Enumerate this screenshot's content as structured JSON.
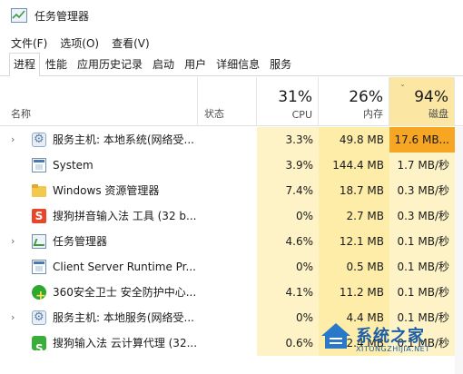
{
  "window": {
    "title": "任务管理器"
  },
  "menu": [
    "文件(F)",
    "选项(O)",
    "查看(V)"
  ],
  "tabs": [
    "进程",
    "性能",
    "应用历史记录",
    "启动",
    "用户",
    "详细信息",
    "服务"
  ],
  "active_tab": 0,
  "columns": {
    "name": "名称",
    "status": "状态",
    "cpu": {
      "pct": "31%",
      "label": "CPU"
    },
    "memory": {
      "pct": "26%",
      "label": "内存"
    },
    "disk": {
      "pct": "94%",
      "label": "磁盘",
      "sort": "ˇ"
    }
  },
  "processes": [
    {
      "expand": "›",
      "icon": "gear-icon",
      "name": "服务主机: 本地系统(网络受...",
      "cpu": "3.3%",
      "memory": "49.8 MB",
      "disk": "17.6 MB...",
      "disk_level": "high"
    },
    {
      "expand": "",
      "icon": "window-icon",
      "name": "System",
      "cpu": "3.9%",
      "memory": "144.4 MB",
      "disk": "1.7 MB/秒",
      "disk_level": "low"
    },
    {
      "expand": "",
      "icon": "folder-icon",
      "name": "Windows 资源管理器",
      "cpu": "7.4%",
      "memory": "18.7 MB",
      "disk": "0.3 MB/秒",
      "disk_level": "low"
    },
    {
      "expand": "",
      "icon": "sogou-icon",
      "icon_text": "S",
      "name": "搜狗拼音输入法 工具 (32 b...",
      "cpu": "0%",
      "memory": "2.7 MB",
      "disk": "0.3 MB/秒",
      "disk_level": "low"
    },
    {
      "expand": "›",
      "icon": "task-manager-icon",
      "name": "任务管理器",
      "cpu": "4.6%",
      "memory": "12.1 MB",
      "disk": "0.1 MB/秒",
      "disk_level": "low"
    },
    {
      "expand": "",
      "icon": "window-icon",
      "name": "Client Server Runtime Pr...",
      "cpu": "0%",
      "memory": "0.5 MB",
      "disk": "0.1 MB/秒",
      "disk_level": "low"
    },
    {
      "expand": "",
      "icon": "360-icon",
      "name": "360安全卫士 安全防护中心...",
      "cpu": "4.1%",
      "memory": "11.2 MB",
      "disk": "0.1 MB/秒",
      "disk_level": "low"
    },
    {
      "expand": "›",
      "icon": "gear-icon",
      "name": "服务主机: 本地服务(网络受...",
      "cpu": "0%",
      "memory": "4.4 MB",
      "disk": "0.1 MB/秒",
      "disk_level": "low"
    },
    {
      "expand": "",
      "icon": "cloud-icon",
      "name": "搜狗输入法 云计算代理 (32...",
      "cpu": "0.6%",
      "memory": "2.4 MB",
      "disk": "0.1 MB/秒",
      "disk_level": "low"
    }
  ],
  "colors": {
    "cpu_cell": "#fdf3c6",
    "mem_cell": "#fdeda8",
    "disk_cell": "#fdf3c6",
    "disk_high": "#f6a623",
    "disk_header": "#fbe7a3"
  },
  "watermark": {
    "text": "系统之家",
    "sub": "XITONGZHIJIA.NET"
  }
}
